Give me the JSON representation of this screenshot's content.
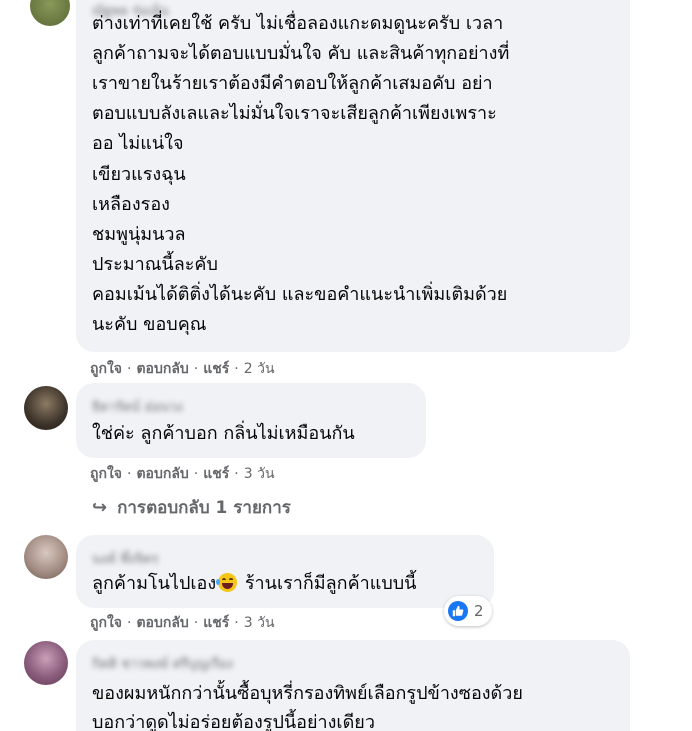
{
  "comments": [
    {
      "lines": [
        "ต่างเท่าที่เคยใช้ ครับ ไม่เชื่อลองแกะดมดูนะครับ เวลา",
        "ลูกค้าถามจะได้ตอบแบบมั่นใจ คับ และสินค้าทุกอย่างที่",
        "เราขายในร้ายเราต้องมีคำตอบให้ลูกค้าเสมอคับ อย่า",
        "ตอบแบบลังเลและไม่มั่นใจเราจะเสียลูกค้าเพียงเพราะ",
        "ออ ไม่แน่ใจ",
        "เขียวแรงฉุน",
        "เหลืองรอง",
        "ชมพูนุ่มนวล",
        "ประมาณนี้ละคับ",
        "คอมเม้นได้ติติ่งได้นะคับ และขอคำแนะนำเพิ่มเติมด้วย",
        "นะคับ ขอบคุณ"
      ],
      "actions": {
        "like": "ถูกใจ",
        "reply": "ตอบกลับ",
        "share": "แชร์",
        "time": "2 วัน"
      }
    },
    {
      "author": "ธิดารัตน์ อ่อนวง",
      "lines": [
        "ใช่ค่ะ ลูกค้าบอก กลิ่นไม่เหมือนกัน"
      ],
      "actions": {
        "like": "ถูกใจ",
        "reply": "ตอบกลับ",
        "share": "แชร์",
        "time": "3 วัน"
      },
      "replies_link": "การตอบกลับ 1 รายการ"
    },
    {
      "author": "นงค์ พึ่งจิตร",
      "text_before_emoji": "ลูกค้ามโนไปเอง",
      "emoji": "rofl-emoji",
      "text_after_emoji": " ร้านเราก็มีลูกค้าแบบนี้",
      "reaction_count": "2",
      "actions": {
        "like": "ถูกใจ",
        "reply": "ตอบกลับ",
        "share": "แชร์",
        "time": "3 วัน"
      }
    },
    {
      "author": "กิตติ ชาวพงษ์ ศรีบุญเรือง",
      "lines": [
        "ของผมหนักกว่านั้นซื้อบุหรี่กรองทิพย์เลือกรูปข้างซองด้วย",
        "บอกว่าดูดไม่อร่อยต้องรูปนี้อย่างเดียว"
      ]
    }
  ],
  "colors": {
    "bubble": "#f0f2f5",
    "text": "#050505",
    "meta": "#65676b",
    "like_blue": "#1877f2"
  }
}
